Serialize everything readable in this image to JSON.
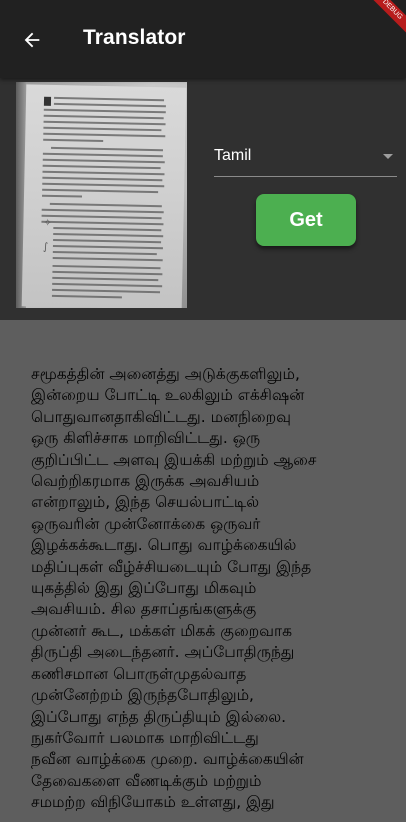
{
  "appbar": {
    "title": "Translator",
    "back_icon": "arrow-back-icon",
    "debug_banner": "DEBUG"
  },
  "image_preview": {
    "icon": "book-photo"
  },
  "language_select": {
    "selected": "Tamil",
    "icon": "dropdown-arrow-icon"
  },
  "get_button": {
    "label": "Get",
    "color": "#4caf50"
  },
  "colors": {
    "appbar": "#212121",
    "top_panel": "#303030",
    "result_panel": "#5e5e5e"
  },
  "result": {
    "text": "சமூகத்தின் அனைத்து அடுக்குகளிலும்,\nஇன்றைய போட்டி உலகிலும் எக்சிஷன்\nபொதுவானதாகிவிட்டது. மனநிறைவு\nஒரு கிளிச்சாக மாறிவிட்டது. ஒரு\nகுறிப்பிட்ட அளவு இயக்கி மற்றும் ஆசை\nவெற்றிகரமாக இருக்க அவசியம்\nஎன்றாலும், இந்த செயல்பாட்டில்\nஒருவரின் முன்னோக்கை ஒருவர்\nஇழக்கக்கூடாது. பொது வாழ்க்கையில்\nமதிப்புகள் வீழ்ச்சியடையும் போது இந்த\nயுகத்தில் இது இப்போது மிகவும்\nஅவசியம். சில தசாப்தங்களுக்கு\nமுன்னர் கூட, மக்கள் மிகக் குறைவாக\nதிருப்தி அடைந்தனர். அப்போதிருந்து\nகணிசமான பொருள்முதல்வாத\nமுன்னேற்றம் இருந்தபோதிலும்,\nஇப்போது எந்த திருப்தியும் இல்லை.\nநுகர்வோர் பலமாக மாறிவிட்டது\nநவீன வாழ்க்கை முறை. வாழ்க்கையின்\nதேவைகளை வீணடிக்கும் மற்றும்\nசமமற்ற விநியோகம் உள்ளது, இது"
  }
}
